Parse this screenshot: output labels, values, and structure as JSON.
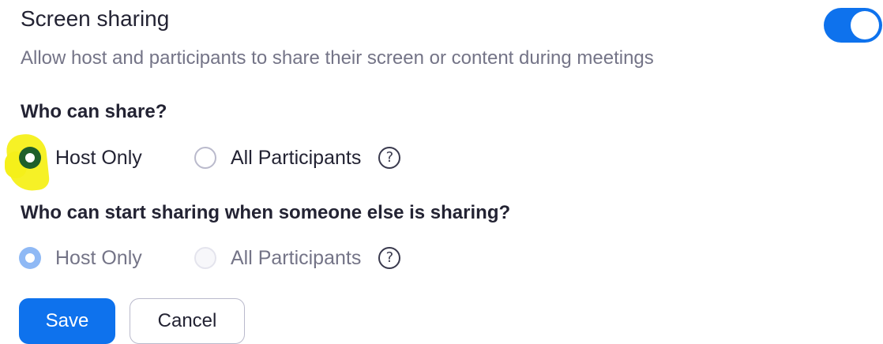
{
  "setting": {
    "title": "Screen sharing",
    "description": "Allow host and participants to share their screen or content during meetings",
    "enabled": true
  },
  "who_can_share": {
    "question": "Who can share?",
    "options": [
      {
        "label": "Host Only",
        "selected": true
      },
      {
        "label": "All Participants",
        "selected": false
      }
    ],
    "help_icon": "?"
  },
  "who_can_start": {
    "question": "Who can start sharing when someone else is sharing?",
    "disabled": true,
    "options": [
      {
        "label": "Host Only",
        "selected": true
      },
      {
        "label": "All Participants",
        "selected": false
      }
    ],
    "help_icon": "?"
  },
  "buttons": {
    "save_label": "Save",
    "cancel_label": "Cancel"
  },
  "colors": {
    "accent": "#0e72ed",
    "annotation_highlight": "#f5f01a"
  }
}
